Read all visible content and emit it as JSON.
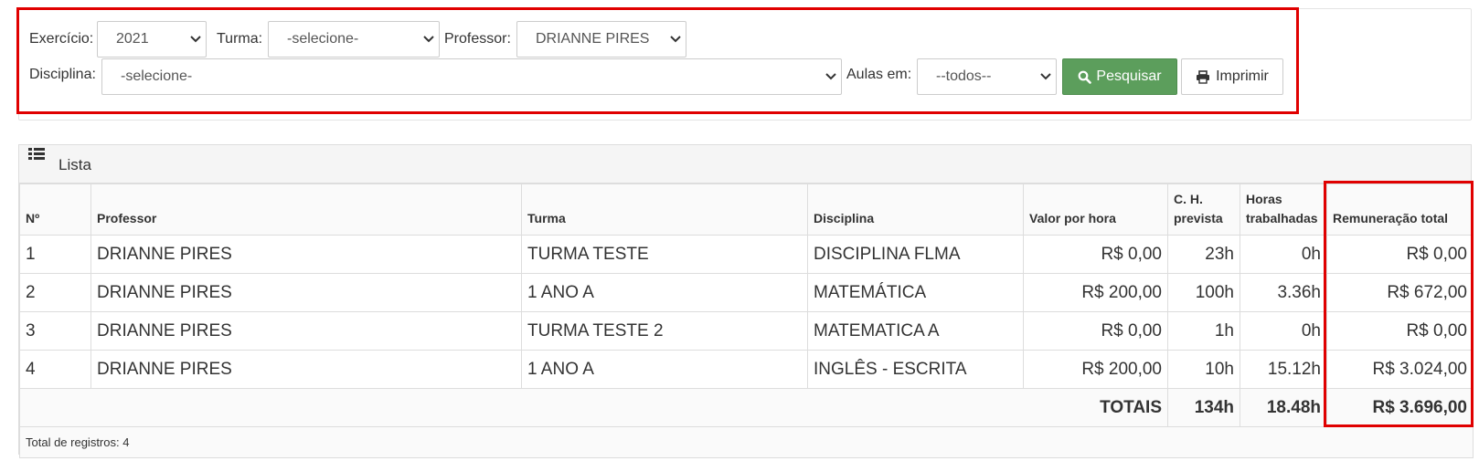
{
  "filters": {
    "exercicio_label": "Exercício:",
    "exercicio_value": "2021",
    "turma_label": "Turma:",
    "turma_value": "-selecione-",
    "professor_label": "Professor:",
    "professor_value": "DRIANNE PIRES",
    "disciplina_label": "Disciplina:",
    "disciplina_value": "-selecione-",
    "aulas_label": "Aulas em:",
    "aulas_value": "--todos--",
    "search_label": "Pesquisar",
    "print_label": "Imprimir"
  },
  "list": {
    "title": "Lista",
    "columns": [
      "Nº",
      "Professor",
      "Turma",
      "Disciplina",
      "Valor por hora",
      "C. H. prevista",
      "Horas trabalhadas",
      "Remuneração total"
    ],
    "rows": [
      [
        "1",
        "DRIANNE PIRES",
        "TURMA TESTE",
        "DISCIPLINA FLMA",
        "R$ 0,00",
        "23h",
        "0h",
        "R$ 0,00"
      ],
      [
        "2",
        "DRIANNE PIRES",
        "1 ANO A",
        "MATEMÁTICA",
        "R$ 200,00",
        "100h",
        "3.36h",
        "R$ 672,00"
      ],
      [
        "3",
        "DRIANNE PIRES",
        "TURMA TESTE 2",
        "MATEMATICA A",
        "R$ 0,00",
        "1h",
        "0h",
        "R$ 0,00"
      ],
      [
        "4",
        "DRIANNE PIRES",
        "1 ANO A",
        "INGLÊS - ESCRITA",
        "R$ 200,00",
        "10h",
        "15.12h",
        "R$ 3.024,00"
      ]
    ],
    "totals": {
      "label": "TOTAIS",
      "ch_prevista": "134h",
      "horas_trabalhadas": "18.48h",
      "remuneracao": "R$ 3.696,00"
    },
    "footer": "Total de registros: 4"
  },
  "colors": {
    "highlight": "#e00000",
    "search_button": "#5c9e5c"
  }
}
